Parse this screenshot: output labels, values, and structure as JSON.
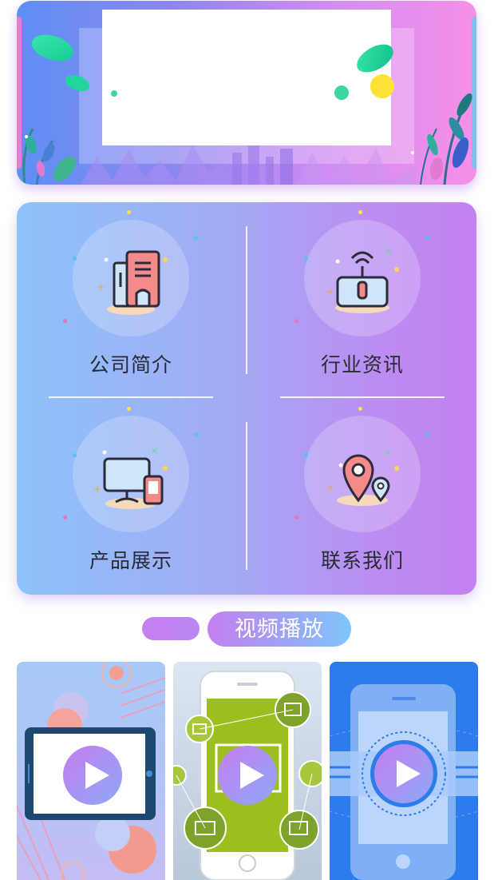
{
  "menu": {
    "items": [
      {
        "label": "公司简介",
        "icon": "building-icon"
      },
      {
        "label": "行业资讯",
        "icon": "router-icon"
      },
      {
        "label": "产品展示",
        "icon": "computer-phone-icon"
      },
      {
        "label": "联系我们",
        "icon": "location-pin-icon"
      }
    ]
  },
  "video_section": {
    "title": "视频播放"
  },
  "videos": [
    {
      "icon": "tablet-play-icon"
    },
    {
      "icon": "phone-app-play-icon"
    },
    {
      "icon": "phone-play-icon"
    }
  ],
  "colors": {
    "banner_gradient": [
      "#5d8ff4",
      "#f590e8"
    ],
    "menu_gradient": [
      "#8ec2fb",
      "#c481f0"
    ],
    "accent_purple": "#c47ff0",
    "accent_blue": "#7fc6fb"
  }
}
